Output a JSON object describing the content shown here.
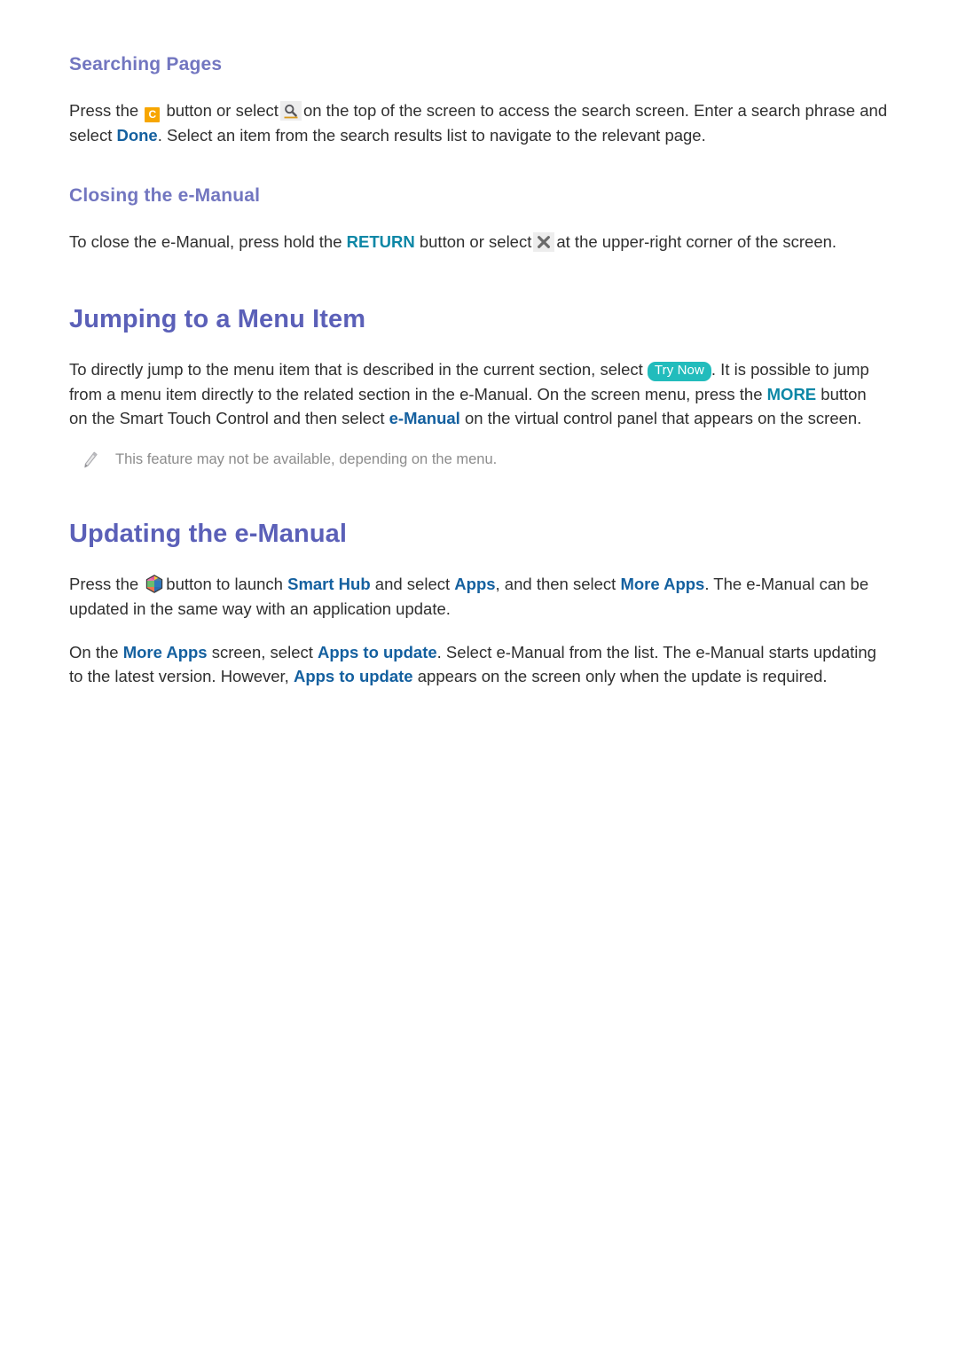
{
  "page": {
    "background": "#ffffff",
    "heading_color_sub": "#7276c0",
    "heading_color_main": "#5b60b8",
    "link_blue": "#14609f",
    "link_teal": "#0d87a6",
    "badge_teal": "#22bcbc",
    "button_yellow": "#f7a600",
    "icon_bg_gray": "#ededed",
    "note_gray": "#8c8c8c",
    "body_color": "#2f2f2f"
  },
  "sections": {
    "searching_pages": {
      "heading": "Searching Pages",
      "paragraph": {
        "p1_a": "Press the",
        "c_button_label": "C",
        "p1_b": "button or select",
        "search_icon_name": "search-icon",
        "p1_c": "on the top of the screen to access the search screen. Enter a search phrase and select",
        "link_done": "Done",
        "p1_d": ". Select an item from the search results list to navigate to the relevant page."
      }
    },
    "closing_emanual": {
      "heading": "Closing the e-Manual",
      "paragraph": {
        "p1_a": "To close the e-Manual, press hold the",
        "link_return": "RETURN",
        "p1_b": "button or select",
        "close_icon_name": "close-x-icon",
        "p1_c": "at the upper-right corner of the screen."
      }
    },
    "jumping_to_menu_item": {
      "heading": "Jumping to a Menu Item",
      "paragraph": {
        "p1_a": "To directly jump to the menu item that is described in the current section, select",
        "badge_try_now": "Try Now",
        "p1_b": ". It is possible to jump from a menu item directly to the related section in the e-Manual. On the screen menu, press the",
        "link_more": "MORE",
        "p1_c": "button on the Smart Touch Control and then select",
        "link_emanual": "e-Manual",
        "p1_d": "on the virtual control panel that appears on the screen."
      },
      "note": {
        "icon_name": "pencil-note-icon",
        "text": "This feature may not be available, depending on the menu."
      }
    },
    "updating_emanual": {
      "heading": "Updating the e-Manual",
      "paragraph1": {
        "p_a": "Press the",
        "smarthub_icon_name": "smart-hub-icon",
        "p_b": "button to launch",
        "link_smart_hub": "Smart Hub",
        "p_c": "and select",
        "link_apps": "Apps",
        "p_d": ", and then select",
        "link_more_apps": "More Apps",
        "p_e": ". The e-Manual can be updated in the same way with an application update."
      },
      "paragraph2": {
        "p_a": "On the",
        "link_more_apps": "More Apps",
        "p_b": "screen, select",
        "link_apps_to_update_1": "Apps to update",
        "p_c": ". Select e-Manual from the list. The e-Manual starts updating to the latest version. However,",
        "link_apps_to_update_2": "Apps to update",
        "p_d": "appears on the screen only when the update is required."
      }
    }
  }
}
